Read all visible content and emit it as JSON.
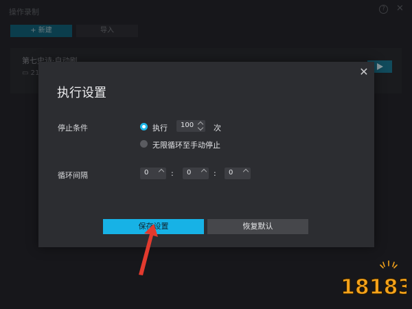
{
  "app": {
    "title": "操作录制",
    "help_icon": "?",
    "close_icon": "✕",
    "new_button": "+ 新建",
    "import_button": "导入",
    "record": {
      "name": "第七史诗·自动刷",
      "date": "21"
    }
  },
  "dialog": {
    "title": "执行设置",
    "close_icon": "✕",
    "stop_condition": {
      "label": "停止条件",
      "option_execute": "执行",
      "times_value": "100",
      "times_unit": "次",
      "option_loop": "无限循环至手动停止",
      "selected": "execute"
    },
    "interval": {
      "label": "循环间隔",
      "hours": "0",
      "minutes": "0",
      "seconds": "0",
      "separator": ":"
    },
    "save_button": "保存设置",
    "restore_button": "恢复默认"
  },
  "colors": {
    "accent": "#17b2e6",
    "arrow": "#e23a2e",
    "logo": "#f4a21a"
  },
  "watermark": {
    "text": "18183"
  }
}
